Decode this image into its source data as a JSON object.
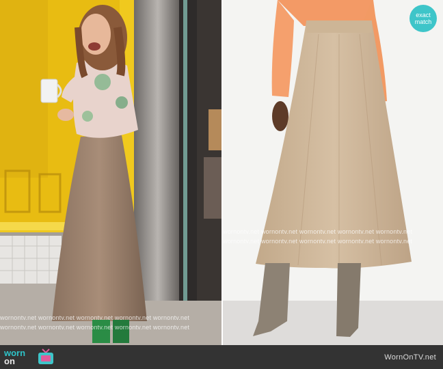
{
  "badge": {
    "line1": "exact",
    "line2": "match"
  },
  "watermark": {
    "row1": "wornontv.net  wornontv.net  wornontv.net  wornontv.net  wornontv.net",
    "row2": "wornontv.net  wornontv.net  wornontv.net  wornontv.net  wornontv.net"
  },
  "footer": {
    "logo_line1": "worn",
    "logo_line2": "on",
    "site_name": "WornOnTV.net"
  },
  "colors": {
    "accent": "#3ec5c9",
    "skirt": "#c9b396",
    "sweater": "#f39a66",
    "boots": "#8d8274"
  }
}
